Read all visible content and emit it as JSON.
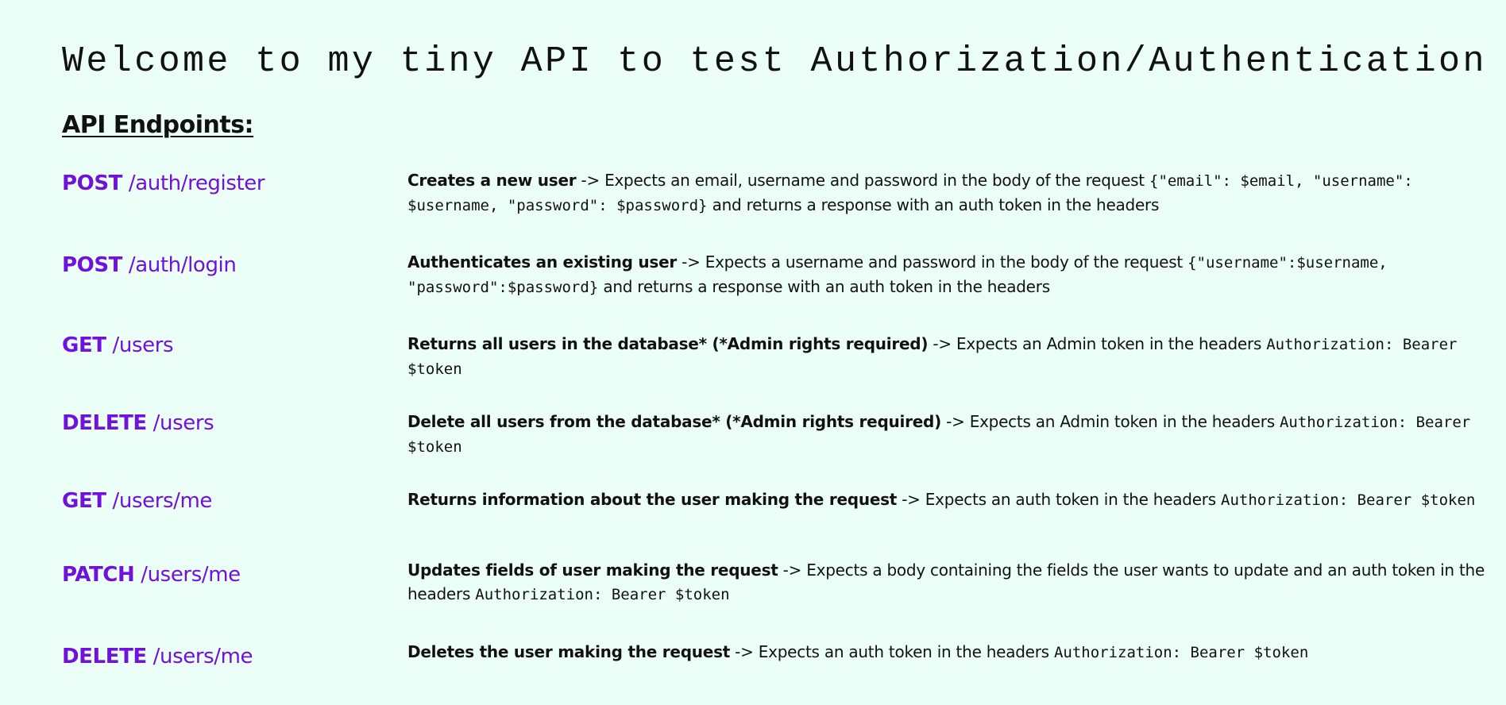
{
  "page": {
    "title": "Welcome to my tiny API to test Authorization/Authentication",
    "section_heading": "API Endpoints:",
    "colors": {
      "background": "#ecfef8",
      "route": "#7011dd",
      "text": "#111111"
    }
  },
  "endpoints": [
    {
      "method": "POST",
      "path": "/auth/register",
      "summary": "Creates a new user",
      "text": " -> Expects an email, username and password in the body of the request ",
      "code": "{\"email\": $email, \"username\": $username, \"password\": $password}",
      "suffix": " and returns a response with an auth token in the headers"
    },
    {
      "method": "POST",
      "path": "/auth/login",
      "summary": "Authenticates an existing user",
      "text": " -> Expects a username and password in the body of the request ",
      "code": "{\"username\":$username, \"password\":$password}",
      "suffix": " and returns a response with an auth token in the headers"
    },
    {
      "method": "GET",
      "path": "/users",
      "summary": "Returns all users in the database* (*Admin rights required)",
      "text": " -> Expects an Admin token in the headers ",
      "code": "Authorization: Bearer $token",
      "suffix": ""
    },
    {
      "method": "DELETE",
      "path": "/users",
      "summary": "Delete all users from the database* (*Admin rights required)",
      "text": " -> Expects an Admin token in the headers ",
      "code": "Authorization: Bearer $token",
      "suffix": ""
    },
    {
      "method": "GET",
      "path": "/users/me",
      "summary": "Returns information about the user making the request",
      "text": " -> Expects an auth token in the headers ",
      "code": "Authorization: Bearer $token",
      "suffix": ""
    },
    {
      "method": "PATCH",
      "path": "/users/me",
      "summary": "Updates fields of user making the request",
      "text": " -> Expects a body containing the fields the user wants to update and an auth token in the headers ",
      "code": "Authorization: Bearer $token",
      "suffix": ""
    },
    {
      "method": "DELETE",
      "path": "/users/me",
      "summary": "Deletes the user making the request",
      "text": " -> Expects an auth token in the headers ",
      "code": "Authorization: Bearer $token",
      "suffix": ""
    }
  ]
}
